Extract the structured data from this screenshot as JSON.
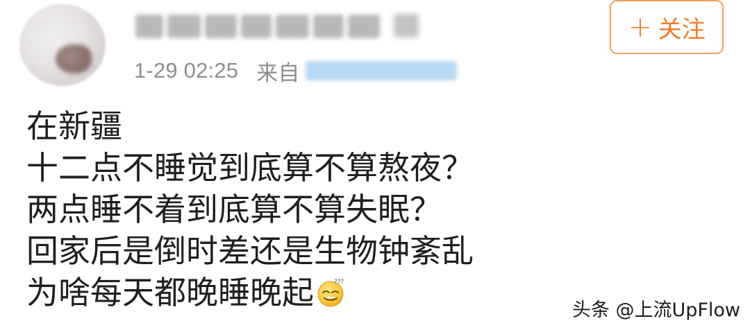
{
  "header": {
    "timestamp": "1-29 02:25",
    "from_label": "来自",
    "follow_plus": "+",
    "follow_label": "关注"
  },
  "post": {
    "lines": [
      "在新疆",
      "十二点不睡觉到底算不算熬夜？",
      "两点睡不着到底算不算失眠？",
      "回家后是倒时差还是生物钟紊乱",
      "为啥每天都晚睡晚起"
    ],
    "emoji": "sleepy-face-emoji"
  },
  "watermark": {
    "text": "头条 @上流UpFlow"
  },
  "colors": {
    "accent": "#f07f2a",
    "border_accent": "#f4a05a",
    "meta_text": "#8e8e8e",
    "body_text": "#1f1f1f"
  }
}
